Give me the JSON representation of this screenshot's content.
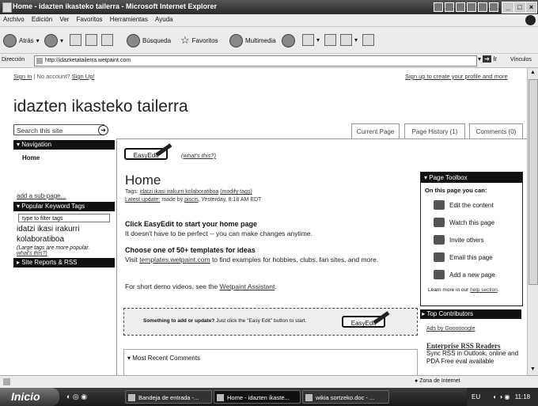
{
  "window": {
    "title": "Home - idazten ikasteko tailerra - Microsoft Internet Explorer"
  },
  "menu": [
    "Archivo",
    "Edición",
    "Ver",
    "Favoritos",
    "Herramientas",
    "Ayuda"
  ],
  "toolbar": {
    "back": "Atrás",
    "search": "Búsqueda",
    "favorites": "Favoritos",
    "multimedia": "Multimedia"
  },
  "address": {
    "label": "Dirección",
    "url": "http://idazketatailerra.wetpaint.com",
    "go": "Ir",
    "links": "Vínculos"
  },
  "page": {
    "top_links": {
      "sign_in": "Sign In",
      "no_account": "| No account?",
      "sign_up": "Sign Up!",
      "right": "Sign up to create your profile and more"
    },
    "site_title": "idazten ikasteko tailerra",
    "search_placeholder": "Search this site",
    "tabs": [
      "Current Page",
      "Page History (1)",
      "Comments (0)"
    ],
    "sidebar": {
      "nav_head": "Navigation",
      "nav_home": "Home",
      "add_sub": "add a sub-page...",
      "kw_head": "Popular Keyword Tags",
      "kw_filter": "type to filter tags",
      "kw_tags": "idatzi ikasi irakurri kolaboratiboa",
      "kw_note": "(Large tags are more popular.",
      "kw_note_link": "what's this?)",
      "reports": "Site Reports & RSS"
    },
    "easyedit": "EasyEdit",
    "whats_this": "(what's this?)",
    "title": "Home",
    "tags_label": "Tags:",
    "tags": "idatzi ikasi irakurri kolaboratiboa",
    "tags_modify": "(modify tags)",
    "latest_label": "Latest update:",
    "latest_text": " made by ",
    "latest_user": "piscis",
    "latest_time": ", Yesterday, 8:18 AM EDT",
    "p1_head": "Click EasyEdit to start your home page",
    "p1_text": "It doesn't have to be perfect -- you can make changes anytime.",
    "p2_head": "Choose one of 50+ templates for ideas",
    "p2_pre": "Visit ",
    "p2_link": "templates.wetpaint.com",
    "p2_post": " to find examples for hobbies, clubs, fan sites, and more.",
    "p3_pre": "For short demo videos, see the ",
    "p3_link": "Wetpaint Assistant",
    "callout_bold": "Something to add or update?",
    "callout_text": " Just click the \"Easy Edit\" button to start.",
    "recent_head": "Most Recent Comments",
    "toolbox": {
      "head": "Page Toolbox",
      "subhead": "On this page you can:",
      "items": [
        "Edit the content",
        "Watch this page",
        "Invite others",
        "Email this page",
        "Add a new page"
      ],
      "learn_pre": "Learn more in our ",
      "learn_link": "help section"
    },
    "top_contributors": "Top Contributors",
    "ads_by": "Ads by Goooooogle",
    "ad_title": "Enterprise RSS Readers",
    "ad_text": "Sync RSS in Outlook, online and PDA Free eval available"
  },
  "status": {
    "zone": "Zona de Internet"
  },
  "taskbar": {
    "start": "Inicio",
    "tasks": [
      "Bandeja de entrada -...",
      "Home - idazten ikaste...",
      "wikia sortzeko.doc - ..."
    ],
    "lang": "EU",
    "time": "11:18"
  }
}
